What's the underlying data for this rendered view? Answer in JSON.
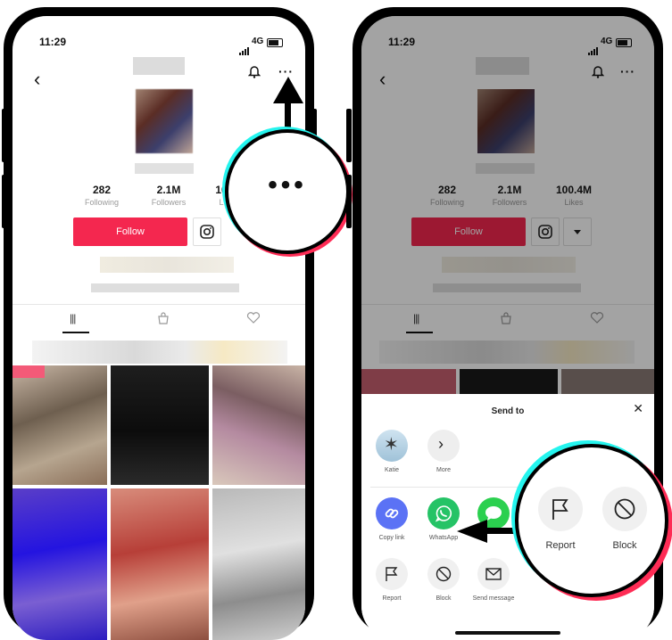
{
  "left_phone": {
    "time": "11:29",
    "network": "4G",
    "stats": [
      {
        "value": "282",
        "label": "Following"
      },
      {
        "value": "2.1M",
        "label": "Followers"
      },
      {
        "value": "10",
        "label": "L"
      }
    ],
    "follow_label": "Follow"
  },
  "right_phone": {
    "time": "11:29",
    "network": "4G",
    "stats": [
      {
        "value": "282",
        "label": "Following"
      },
      {
        "value": "2.1M",
        "label": "Followers"
      },
      {
        "value": "100.4M",
        "label": "Likes"
      }
    ],
    "follow_label": "Follow",
    "share_sheet": {
      "title": "Send to",
      "contacts": [
        {
          "label": "Katie"
        },
        {
          "label": "More"
        }
      ],
      "apps": [
        {
          "label": "Copy link",
          "color": "#5b72f5"
        },
        {
          "label": "WhatsApp",
          "color": "#25c366"
        },
        {
          "label": "",
          "color": "#2bd04f"
        }
      ],
      "actions": [
        {
          "label": "Report"
        },
        {
          "label": "Block"
        },
        {
          "label": "Send message"
        }
      ]
    }
  },
  "callout_more": {
    "glyph": "•••"
  },
  "callout_actions": {
    "report": "Report",
    "block": "Block"
  },
  "colors": {
    "accent": "#f4274f",
    "tiktok_cyan": "#25f4ee",
    "tiktok_red": "#fe2c55"
  }
}
